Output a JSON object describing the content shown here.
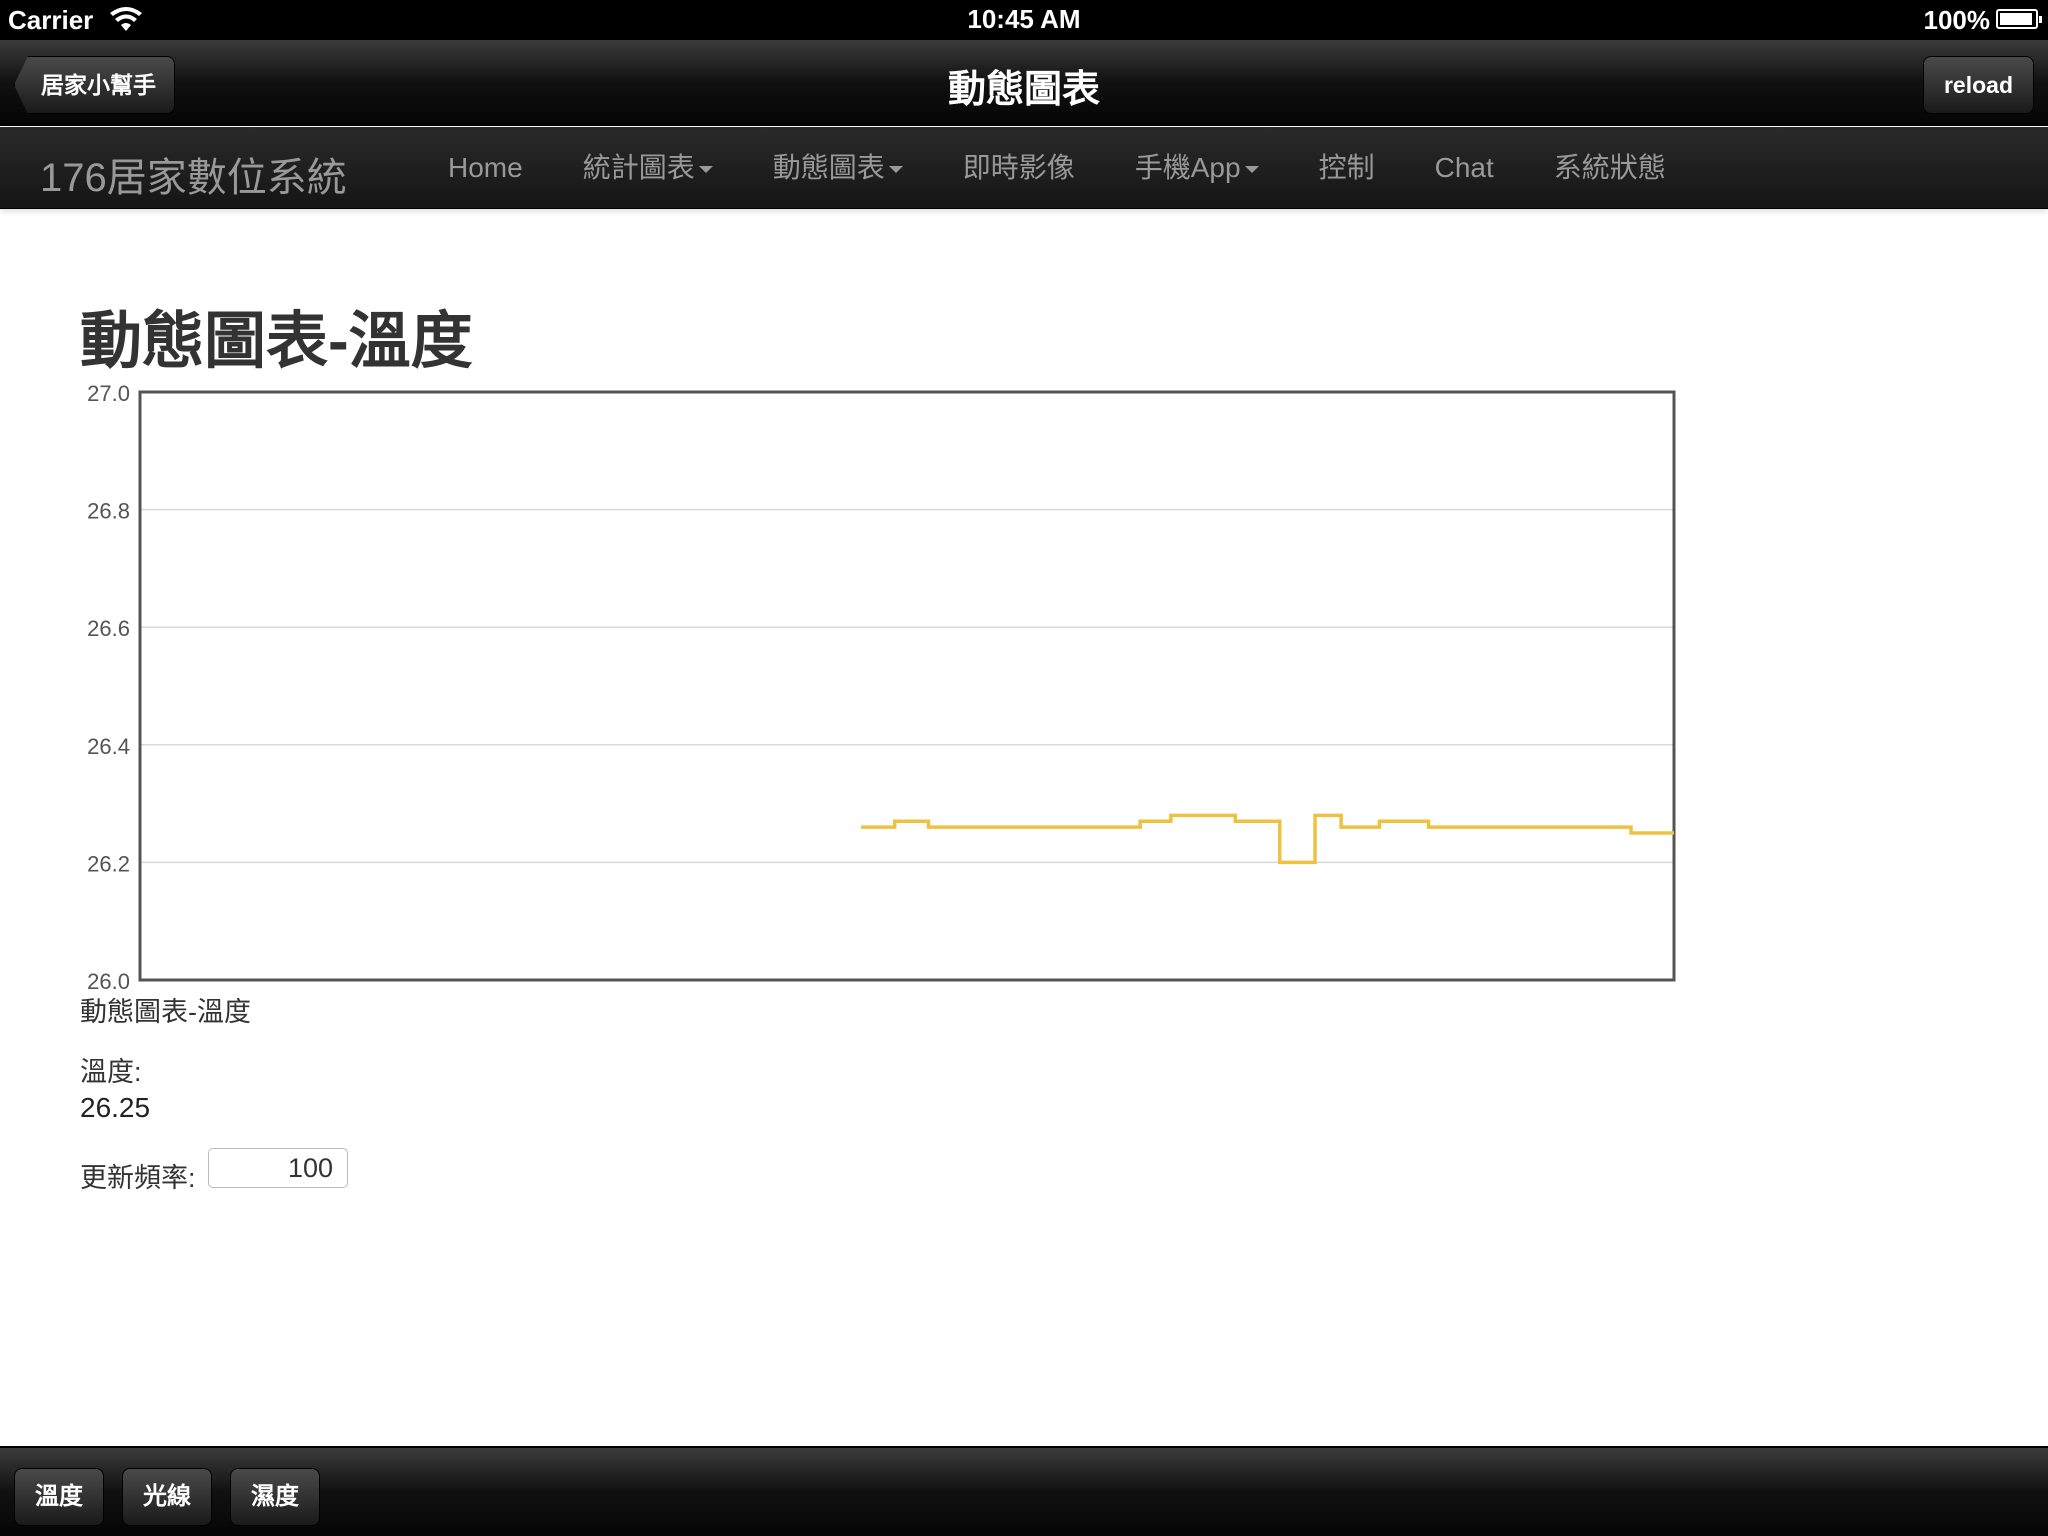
{
  "status_bar": {
    "carrier": "Carrier",
    "time": "10:45 AM",
    "battery": "100%"
  },
  "nav": {
    "title": "動態圖表",
    "back_label": "居家小幫手",
    "reload_label": "reload"
  },
  "site": {
    "brand": "176居家數位系統",
    "menu": [
      {
        "label": "Home",
        "dropdown": false
      },
      {
        "label": "統計圖表",
        "dropdown": true
      },
      {
        "label": "動態圖表",
        "dropdown": true
      },
      {
        "label": "即時影像",
        "dropdown": false
      },
      {
        "label": "手機App",
        "dropdown": true
      },
      {
        "label": "控制",
        "dropdown": false
      },
      {
        "label": "Chat",
        "dropdown": false
      },
      {
        "label": "系統狀態",
        "dropdown": false
      }
    ]
  },
  "page": {
    "heading": "動態圖表-溫度",
    "caption": "動態圖表-溫度",
    "temp_label": "溫度:",
    "temp_value": "26.25",
    "rate_label": "更新頻率:",
    "rate_value": "100"
  },
  "chart_data": {
    "type": "line",
    "title": "",
    "xlabel": "",
    "ylabel": "",
    "ylim": [
      26.0,
      27.0
    ],
    "yticks": [
      "27.0",
      "26.8",
      "26.6",
      "26.4",
      "26.2",
      "26.0"
    ],
    "xlim": [
      0,
      100
    ],
    "grid": true,
    "step": true,
    "color": "#edc240",
    "series": [
      {
        "x": [
          47,
          49.2,
          51.4,
          60.8,
          65.2,
          67.2,
          71.4,
          72.9,
          74.3,
          76.2,
          76.6,
          78.3,
          80.8,
          84.0,
          97.0,
          97.2,
          100
        ],
        "values": [
          26.26,
          26.27,
          26.26,
          26.26,
          26.27,
          26.28,
          26.27,
          26.27,
          26.2,
          26.2,
          26.28,
          26.26,
          26.27,
          26.26,
          26.26,
          26.25,
          26.25
        ]
      }
    ]
  },
  "toolbar": {
    "buttons": [
      "溫度",
      "光線",
      "濕度"
    ]
  }
}
